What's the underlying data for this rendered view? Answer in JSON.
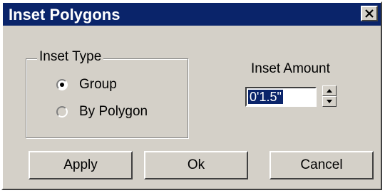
{
  "dialog": {
    "title": "Inset Polygons",
    "close_icon": "close-icon"
  },
  "inset_type": {
    "label": "Inset Type",
    "options": [
      {
        "label": "Group",
        "selected": true
      },
      {
        "label": "By Polygon",
        "selected": false
      }
    ]
  },
  "inset_amount": {
    "label": "Inset Amount",
    "value": "0'1.5\""
  },
  "buttons": {
    "apply": "Apply",
    "ok": "Ok",
    "cancel": "Cancel"
  }
}
